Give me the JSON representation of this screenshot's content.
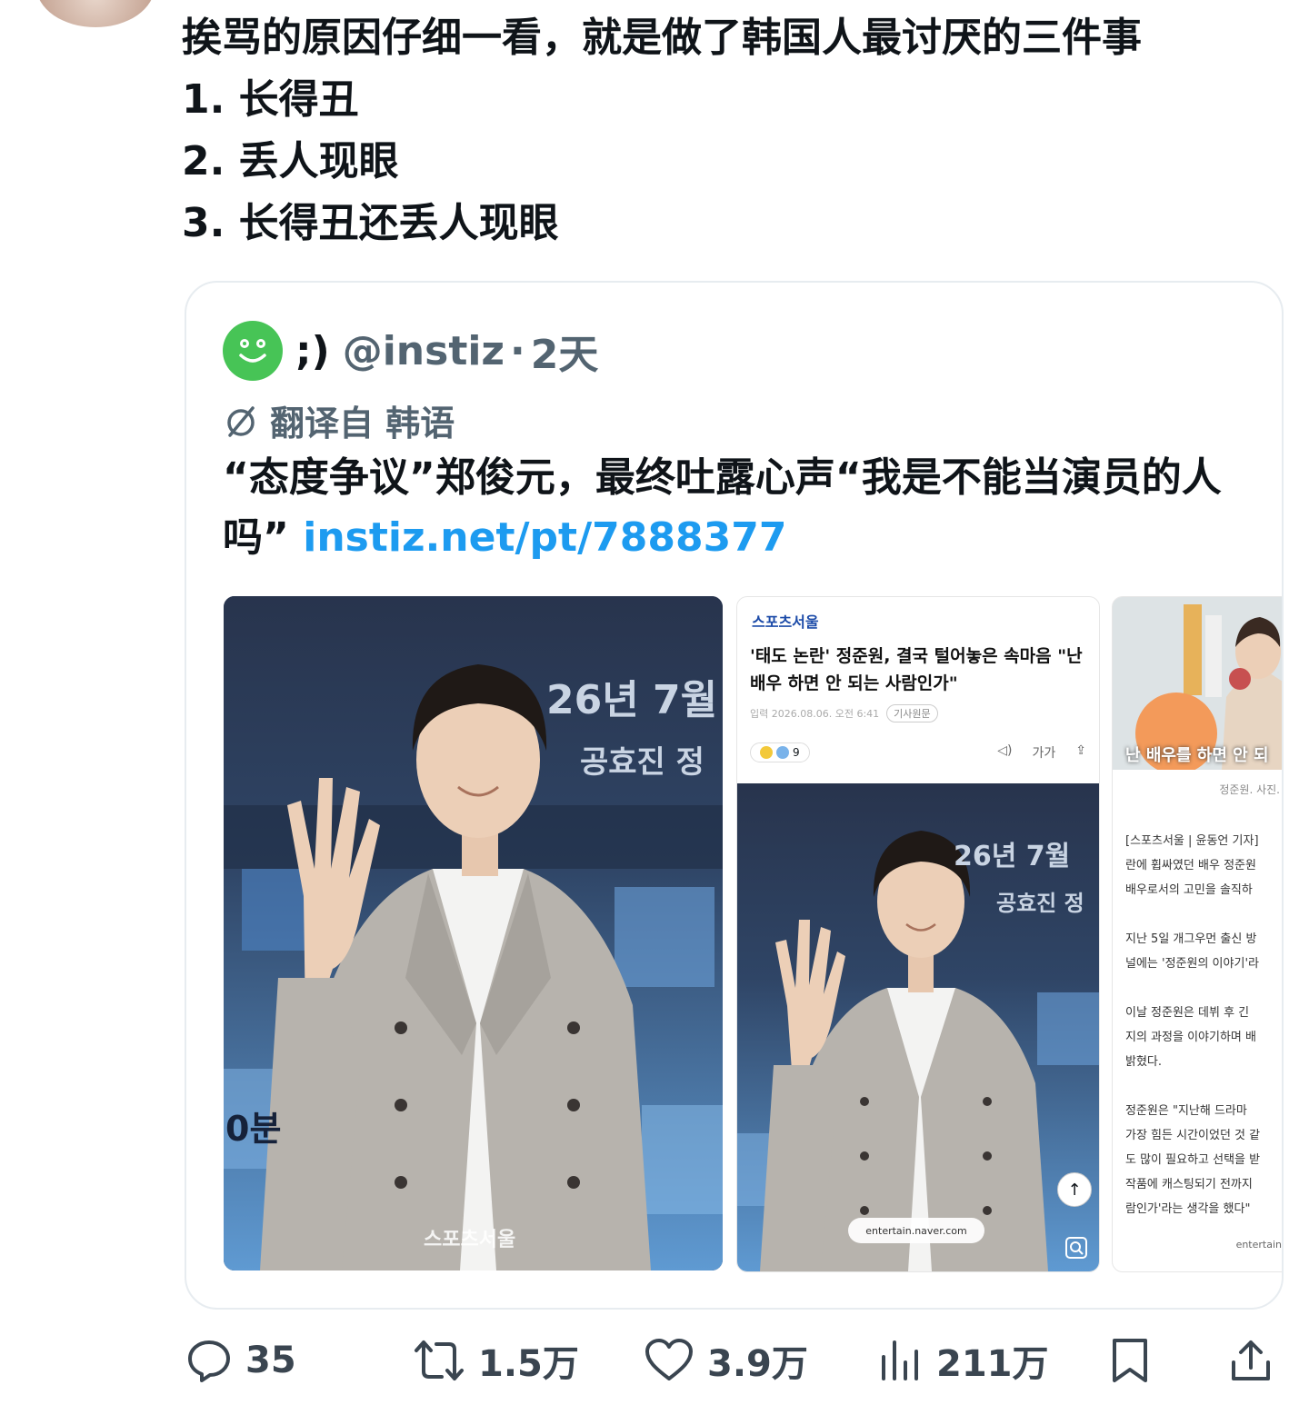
{
  "tweet": {
    "lines": [
      "挨骂的原因仔细一看，就是做了韩国人最讨厌的三件事",
      "1. 长得丑",
      "2. 丢人现眼",
      "3. 长得丑还丢人现眼"
    ]
  },
  "quote": {
    "name": ";)",
    "handle": "@instiz",
    "dot": "·",
    "time": "2天",
    "translated_from": "翻译自 韩语",
    "body_text": "“态度争议”郑俊元，最终吐露心声“我是不能当演员的人吗” ",
    "link_text": "instiz.net/pt/7888377",
    "avatar_color": "#47c456",
    "link_color": "#1d9bf0"
  },
  "media1": {
    "backdrop_text_1": "26년 7월",
    "backdrop_text_2": "공효진 정",
    "backdrop_text_3": "0분",
    "watermark": "스포츠서울"
  },
  "media2": {
    "brand": "스포츠서울",
    "title": "'태도 논란' 정준원, 결국 털어놓은 속마음 \"난 배우 하면 안 되는 사람인가\"",
    "meta_date": "입력 2026.08.06. 오전 6:41",
    "meta_tag": "기사원문",
    "reaction_count": "9",
    "tool_sound": "◁)",
    "tool_font": "가가",
    "tool_share": "⇪",
    "up_arrow": "↑",
    "url": "entertain.naver.com",
    "backdrop_text_1": "26년 7월",
    "backdrop_text_2": "공효진 정"
  },
  "media3": {
    "overlay_text": "난 배우를 하면 안 되",
    "caption": "정준원. 사진.",
    "paragraphs": [
      [
        "[스포츠서울 | 윤동언 기자]",
        "란에 휩싸였던 배우 정준원",
        "배우로서의 고민을 솔직하"
      ],
      [
        "지난 5일 개그우먼 출신 방",
        "널에는 '정준원의 이야기'라"
      ],
      [
        "이날 정준원은 데뷔 후 긴",
        "지의 과정을 이야기하며 배",
        "밝혔다."
      ],
      [
        "정준원은 \"지난해 드라마",
        "가장 힘든 시간이었던 것 같",
        "도 많이 필요하고 선택을 받",
        "작품에 캐스팅되기 전까지",
        "람인가'라는 생각을 했다\""
      ]
    ],
    "footer": "entertain"
  },
  "actions": {
    "replies": "35",
    "reposts": "1.5万",
    "likes": "3.9万",
    "views": "211万"
  }
}
